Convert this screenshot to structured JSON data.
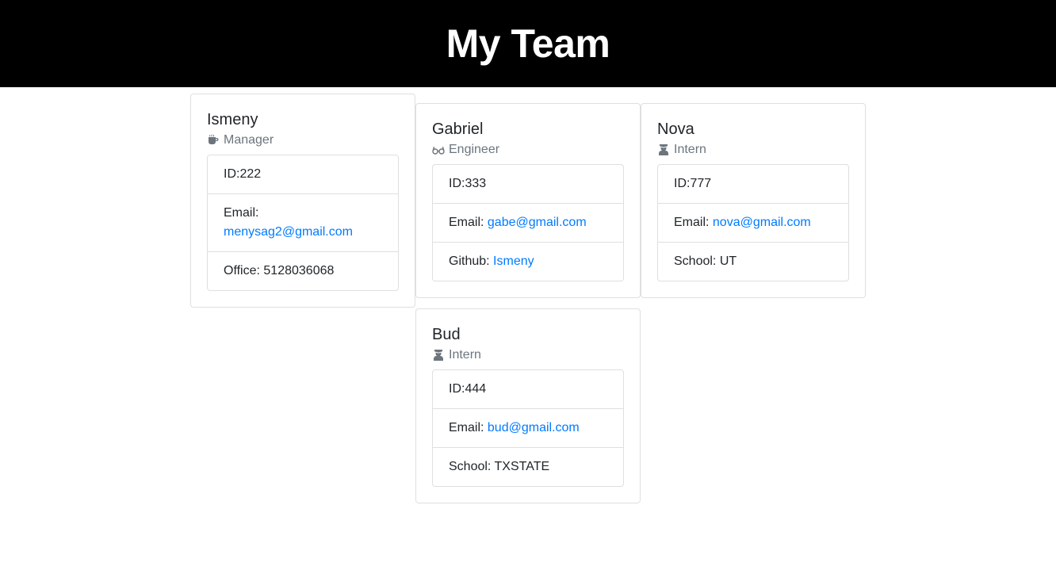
{
  "header": {
    "title": "My Team"
  },
  "cards": [
    {
      "name": "Ismeny",
      "role": "Manager",
      "role_icon": "coffee-icon",
      "id_label": "ID:",
      "id": "222",
      "email_label": "Email:",
      "email": "menysag2@gmail.com",
      "extra_label": "Office:",
      "extra_value": "5128036068"
    },
    {
      "name": "Gabriel",
      "role": "Engineer",
      "role_icon": "glasses-icon",
      "id_label": "ID:",
      "id": "333",
      "email_label": "Email:",
      "email": "gabe@gmail.com",
      "extra_label": "Github:",
      "extra_value": "Ismeny"
    },
    {
      "name": "Nova",
      "role": "Intern",
      "role_icon": "graduate-icon",
      "id_label": "ID:",
      "id": "777",
      "email_label": "Email:",
      "email": "nova@gmail.com",
      "extra_label": "School:",
      "extra_value": "UT"
    },
    {
      "name": "Bud",
      "role": "Intern",
      "role_icon": "graduate-icon",
      "id_label": "ID:",
      "id": "444",
      "email_label": "Email:",
      "email": "bud@gmail.com",
      "extra_label": "School:",
      "extra_value": "TXSTATE"
    }
  ],
  "colors": {
    "header_bg": "#000000",
    "link": "#007bff",
    "muted": "#6c757d",
    "border": "#dfdfdf"
  }
}
